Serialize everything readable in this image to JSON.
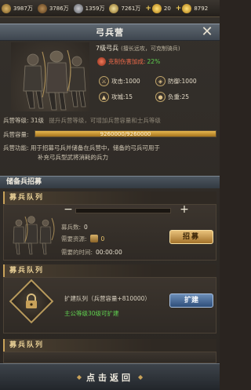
{
  "resources": [
    {
      "icon": "food-icon",
      "value": "3987万"
    },
    {
      "icon": "wood-icon",
      "value": "3786万"
    },
    {
      "icon": "iron-icon",
      "value": "1359万"
    },
    {
      "icon": "silver-icon",
      "value": "7261万"
    },
    {
      "icon": "ingot-icon",
      "value": "20"
    },
    {
      "icon": "gold-icon",
      "value": "8792"
    }
  ],
  "title": "弓兵营",
  "unit": {
    "name": "7级弓兵",
    "sub": "(擅长远攻，可克制骑兵)",
    "counter_label": "克制伤害加成:",
    "counter_value": "22%",
    "stats": {
      "attack": "攻击:1000",
      "defense": "防御:1000",
      "siege": "攻城:15",
      "load": "负重:25"
    }
  },
  "info": {
    "level_label": "兵营等级:",
    "level_value": "31级",
    "level_hint": "提升兵营等级，可增加兵营容量和士兵等级",
    "capacity_label": "兵营容量:",
    "capacity_text": "9260000/9260000",
    "capacity_fill": 1.0,
    "func_label": "兵营功能:",
    "func_line1": "用于招募弓兵并储备在兵营中，储备的弓兵可用于",
    "func_line2": "补充弓兵型武将消耗的兵力"
  },
  "reserve_header": "储备兵招募",
  "queue1": {
    "title": "募兵队列",
    "minus": "−",
    "plus": "+",
    "count_label": "募兵数:",
    "count_value": "0",
    "resource_label": "需要资源:",
    "resource_value": "0",
    "time_label": "需要的时间:",
    "time_value": "00:00:00",
    "button": "招募"
  },
  "queue2": {
    "title": "募兵队列",
    "expand_text": "扩建队列（兵营容量+810000）",
    "requirement": "主公等级30级可扩建",
    "button": "扩建"
  },
  "queue3": {
    "title": "募兵队列"
  },
  "back_button": "点击返回",
  "colors": {
    "accent_gold": "#c9a25a",
    "green": "#5fd04f",
    "red": "#ef6a4a"
  }
}
